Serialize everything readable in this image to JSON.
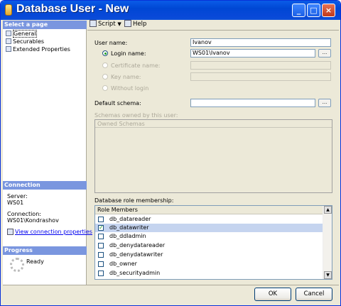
{
  "window": {
    "title": "Database User - New",
    "minimize": "_",
    "maximize": "□",
    "close": "×"
  },
  "left_pane": {
    "select_page_header": "Select a page",
    "pages": [
      {
        "label": "General",
        "selected": true
      },
      {
        "label": "Securables",
        "selected": false
      },
      {
        "label": "Extended Properties",
        "selected": false
      }
    ],
    "connection_header": "Connection",
    "server_label": "Server:",
    "server_value": "WS01",
    "connection_label": "Connection:",
    "connection_value": "WS01\\Kondrashov",
    "view_connection_link": "View connection properties",
    "progress_header": "Progress",
    "progress_status": "Ready"
  },
  "toolbar": {
    "script_label": "Script",
    "help_label": "Help"
  },
  "form": {
    "user_name_label": "User name:",
    "user_name_value": "Ivanov",
    "login_name_label": "Login name:",
    "login_name_value": "WS01\\Ivanov",
    "certificate_name_label": "Certificate name:",
    "certificate_name_value": "",
    "key_name_label": "Key name:",
    "key_name_value": "",
    "without_login_label": "Without login",
    "default_schema_label": "Default schema:",
    "default_schema_value": "",
    "browse": "...",
    "schemas_owned_label": "Schemas owned by this user:",
    "owned_schemas_header": "Owned Schemas",
    "role_membership_label": "Database role membership:",
    "role_members_header": "Role Members",
    "roles": [
      {
        "name": "db_datareader",
        "checked": false,
        "selected": false
      },
      {
        "name": "db_datawriter",
        "checked": true,
        "selected": true
      },
      {
        "name": "db_ddladmin",
        "checked": false,
        "selected": false
      },
      {
        "name": "db_denydatareader",
        "checked": false,
        "selected": false
      },
      {
        "name": "db_denydatawriter",
        "checked": false,
        "selected": false
      },
      {
        "name": "db_owner",
        "checked": false,
        "selected": false
      },
      {
        "name": "db_securityadmin",
        "checked": false,
        "selected": false
      }
    ]
  },
  "buttons": {
    "ok": "OK",
    "cancel": "Cancel"
  },
  "colors": {
    "title_bar": "#0047d4",
    "section_header": "#7a96df",
    "window_background": "#ece9d8",
    "link": "#0000ee"
  }
}
